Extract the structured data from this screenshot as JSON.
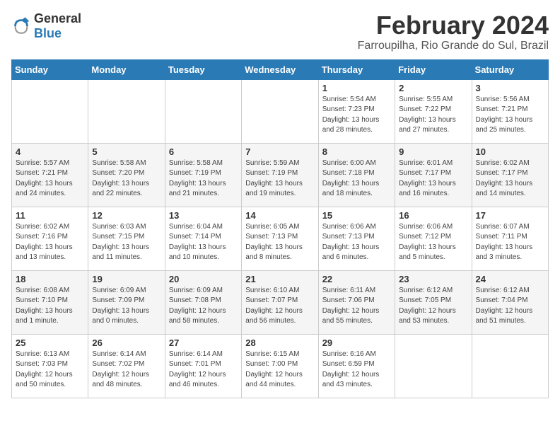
{
  "header": {
    "logo_general": "General",
    "logo_blue": "Blue",
    "month_year": "February 2024",
    "location": "Farroupilha, Rio Grande do Sul, Brazil"
  },
  "weekdays": [
    "Sunday",
    "Monday",
    "Tuesday",
    "Wednesday",
    "Thursday",
    "Friday",
    "Saturday"
  ],
  "weeks": [
    [
      {
        "day": "",
        "info": ""
      },
      {
        "day": "",
        "info": ""
      },
      {
        "day": "",
        "info": ""
      },
      {
        "day": "",
        "info": ""
      },
      {
        "day": "1",
        "info": "Sunrise: 5:54 AM\nSunset: 7:23 PM\nDaylight: 13 hours\nand 28 minutes."
      },
      {
        "day": "2",
        "info": "Sunrise: 5:55 AM\nSunset: 7:22 PM\nDaylight: 13 hours\nand 27 minutes."
      },
      {
        "day": "3",
        "info": "Sunrise: 5:56 AM\nSunset: 7:21 PM\nDaylight: 13 hours\nand 25 minutes."
      }
    ],
    [
      {
        "day": "4",
        "info": "Sunrise: 5:57 AM\nSunset: 7:21 PM\nDaylight: 13 hours\nand 24 minutes."
      },
      {
        "day": "5",
        "info": "Sunrise: 5:58 AM\nSunset: 7:20 PM\nDaylight: 13 hours\nand 22 minutes."
      },
      {
        "day": "6",
        "info": "Sunrise: 5:58 AM\nSunset: 7:19 PM\nDaylight: 13 hours\nand 21 minutes."
      },
      {
        "day": "7",
        "info": "Sunrise: 5:59 AM\nSunset: 7:19 PM\nDaylight: 13 hours\nand 19 minutes."
      },
      {
        "day": "8",
        "info": "Sunrise: 6:00 AM\nSunset: 7:18 PM\nDaylight: 13 hours\nand 18 minutes."
      },
      {
        "day": "9",
        "info": "Sunrise: 6:01 AM\nSunset: 7:17 PM\nDaylight: 13 hours\nand 16 minutes."
      },
      {
        "day": "10",
        "info": "Sunrise: 6:02 AM\nSunset: 7:17 PM\nDaylight: 13 hours\nand 14 minutes."
      }
    ],
    [
      {
        "day": "11",
        "info": "Sunrise: 6:02 AM\nSunset: 7:16 PM\nDaylight: 13 hours\nand 13 minutes."
      },
      {
        "day": "12",
        "info": "Sunrise: 6:03 AM\nSunset: 7:15 PM\nDaylight: 13 hours\nand 11 minutes."
      },
      {
        "day": "13",
        "info": "Sunrise: 6:04 AM\nSunset: 7:14 PM\nDaylight: 13 hours\nand 10 minutes."
      },
      {
        "day": "14",
        "info": "Sunrise: 6:05 AM\nSunset: 7:13 PM\nDaylight: 13 hours\nand 8 minutes."
      },
      {
        "day": "15",
        "info": "Sunrise: 6:06 AM\nSunset: 7:13 PM\nDaylight: 13 hours\nand 6 minutes."
      },
      {
        "day": "16",
        "info": "Sunrise: 6:06 AM\nSunset: 7:12 PM\nDaylight: 13 hours\nand 5 minutes."
      },
      {
        "day": "17",
        "info": "Sunrise: 6:07 AM\nSunset: 7:11 PM\nDaylight: 13 hours\nand 3 minutes."
      }
    ],
    [
      {
        "day": "18",
        "info": "Sunrise: 6:08 AM\nSunset: 7:10 PM\nDaylight: 13 hours\nand 1 minute."
      },
      {
        "day": "19",
        "info": "Sunrise: 6:09 AM\nSunset: 7:09 PM\nDaylight: 13 hours\nand 0 minutes."
      },
      {
        "day": "20",
        "info": "Sunrise: 6:09 AM\nSunset: 7:08 PM\nDaylight: 12 hours\nand 58 minutes."
      },
      {
        "day": "21",
        "info": "Sunrise: 6:10 AM\nSunset: 7:07 PM\nDaylight: 12 hours\nand 56 minutes."
      },
      {
        "day": "22",
        "info": "Sunrise: 6:11 AM\nSunset: 7:06 PM\nDaylight: 12 hours\nand 55 minutes."
      },
      {
        "day": "23",
        "info": "Sunrise: 6:12 AM\nSunset: 7:05 PM\nDaylight: 12 hours\nand 53 minutes."
      },
      {
        "day": "24",
        "info": "Sunrise: 6:12 AM\nSunset: 7:04 PM\nDaylight: 12 hours\nand 51 minutes."
      }
    ],
    [
      {
        "day": "25",
        "info": "Sunrise: 6:13 AM\nSunset: 7:03 PM\nDaylight: 12 hours\nand 50 minutes."
      },
      {
        "day": "26",
        "info": "Sunrise: 6:14 AM\nSunset: 7:02 PM\nDaylight: 12 hours\nand 48 minutes."
      },
      {
        "day": "27",
        "info": "Sunrise: 6:14 AM\nSunset: 7:01 PM\nDaylight: 12 hours\nand 46 minutes."
      },
      {
        "day": "28",
        "info": "Sunrise: 6:15 AM\nSunset: 7:00 PM\nDaylight: 12 hours\nand 44 minutes."
      },
      {
        "day": "29",
        "info": "Sunrise: 6:16 AM\nSunset: 6:59 PM\nDaylight: 12 hours\nand 43 minutes."
      },
      {
        "day": "",
        "info": ""
      },
      {
        "day": "",
        "info": ""
      }
    ]
  ]
}
